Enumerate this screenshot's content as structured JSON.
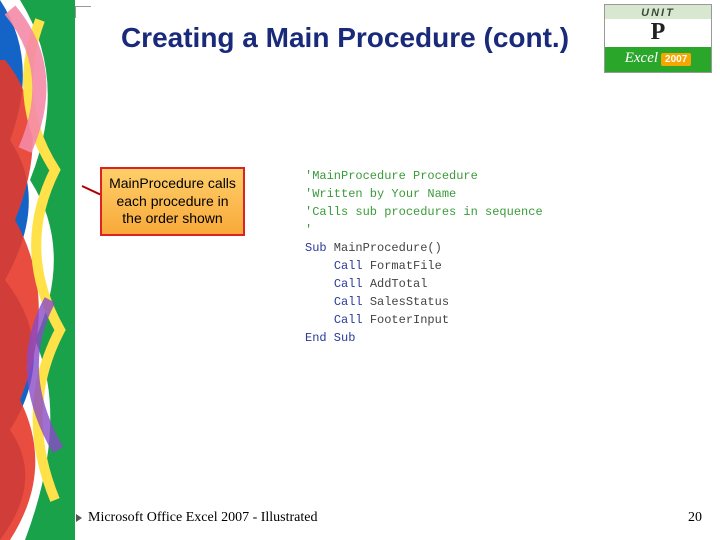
{
  "title": "Creating a Main Procedure (cont.)",
  "unit_badge": {
    "label": "UNIT",
    "letter": "P",
    "brand": "Excel",
    "year": "2007"
  },
  "callout": "MainProcedure calls each procedure in the order shown",
  "code": {
    "comment1": "'MainProcedure Procedure",
    "comment2": "'Written by Your Name",
    "comment3": "'Calls sub procedures in sequence",
    "comment4": "'",
    "sub_kw": "Sub",
    "sub_name": " MainProcedure()",
    "call_kw": "Call",
    "call1": " FormatFile",
    "call2": " AddTotal",
    "call3": " SalesStatus",
    "call4": " FooterInput",
    "end_kw": "End Sub"
  },
  "footer": {
    "left": "Microsoft Office Excel 2007 - Illustrated",
    "page": "20"
  }
}
